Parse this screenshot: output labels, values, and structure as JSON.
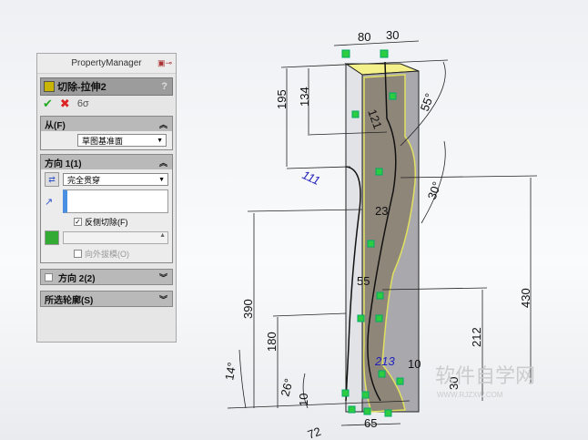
{
  "property_manager": {
    "title": "PropertyManager",
    "feature_name": "切除-拉伸2",
    "help": "?",
    "ok": "✔",
    "cancel": "✖",
    "detail": "6σ",
    "from": {
      "label": "从(F)",
      "value": "草图基准面"
    },
    "direction1": {
      "label": "方向 1(1)",
      "end_condition": "完全贯穿",
      "flip_side_label": "反侧切除(F)",
      "flip_side_checked": true,
      "draft_label": "向外拔模(O)",
      "draft_checked": false
    },
    "direction2": {
      "label": "方向 2(2)"
    },
    "selected_contours": {
      "label": "所选轮廓(S)"
    }
  },
  "dimensions": {
    "d80": "80",
    "d30": "30",
    "d195": "195",
    "d134": "134",
    "d121": "121",
    "d55deg": "55°",
    "d111": "111",
    "d30deg": "30°",
    "d23": "23",
    "d430": "430",
    "d55": "55",
    "d390": "390",
    "d180": "180",
    "d212": "212",
    "d213": "213",
    "d10a": "10",
    "d14deg": "14°",
    "d26deg": "26°",
    "d10b": "10",
    "d65": "65",
    "d72": "72",
    "d30b": "30"
  },
  "watermark": {
    "text": "软件自学网",
    "url": "WWW.RJZXW.COM"
  }
}
